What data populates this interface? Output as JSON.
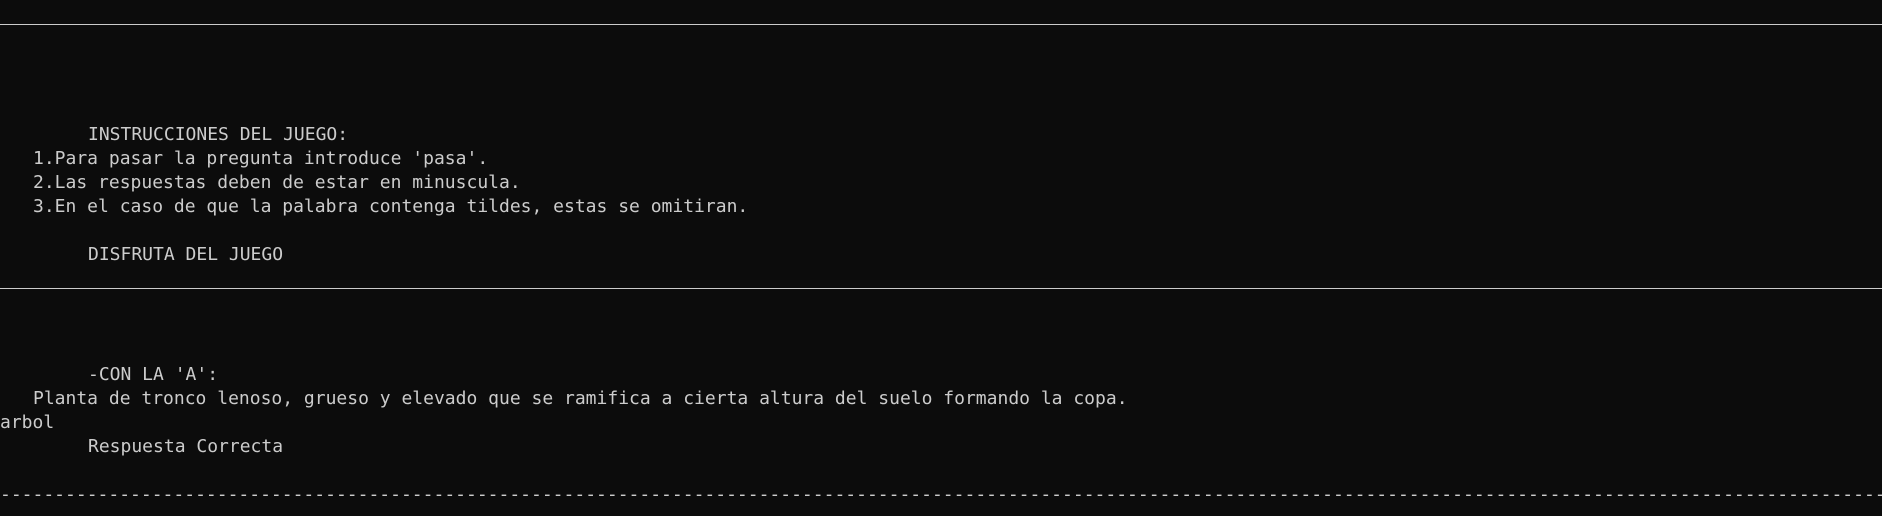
{
  "console": {
    "instructions": {
      "heading": "INSTRUCCIONES DEL JUEGO:",
      "items": [
        "1.Para pasar la pregunta introduce 'pasa'.",
        "2.Las respuestas deben de estar en minuscula.",
        "3.En el caso de que la palabra contenga tildes, estas se omitiran."
      ],
      "footer": "DISFRUTA DEL JUEGO"
    },
    "question": {
      "letter_label": "-CON LA 'A':",
      "definition": "Planta de tronco lenoso, grueso y elevado que se ramifica a cierta altura del suelo formando la copa.",
      "user_answer": "arbol",
      "result": "Respuesta Correcta"
    },
    "separator": "--------------------------------------------------------------------------------------------------------------------------------------------------------------------------------------------"
  }
}
